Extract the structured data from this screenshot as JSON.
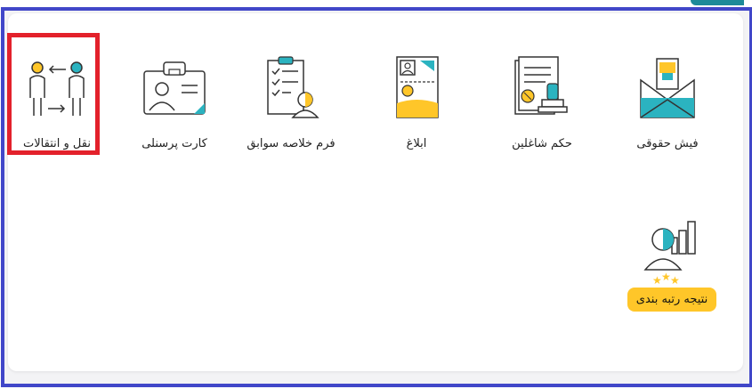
{
  "colors": {
    "frame": "#4147c9",
    "highlight": "#e3212b",
    "accent_teal": "#2bb3c0",
    "accent_yellow": "#ffc629",
    "tab": "#1d8a99"
  },
  "tiles": [
    {
      "label": "فیش حقوقی",
      "icon": "payslip-envelope-icon"
    },
    {
      "label": "حکم شاغلین",
      "icon": "employment-decree-stamp-icon"
    },
    {
      "label": "ابلاغ",
      "icon": "notification-document-icon"
    },
    {
      "label": "فرم خلاصه سوابق",
      "icon": "records-checklist-icon"
    },
    {
      "label": "کارت پرسنلی",
      "icon": "personnel-id-card-icon"
    },
    {
      "label": "نقل و انتقالات",
      "icon": "transfer-people-icon"
    }
  ],
  "ranking": {
    "label": "نتیجه رتبه بندی",
    "icon": "ranking-result-icon"
  }
}
